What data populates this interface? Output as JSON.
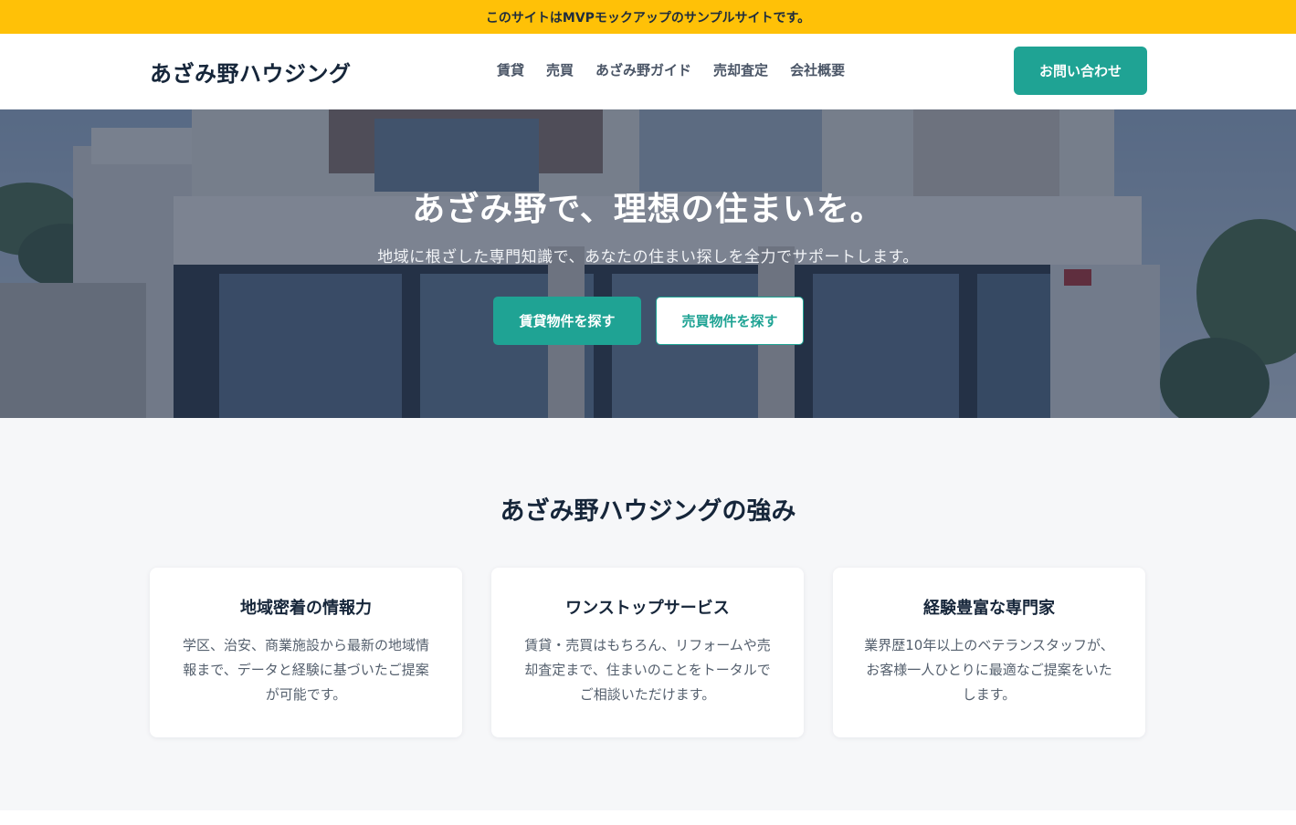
{
  "banner": {
    "text": "このサイトはMVPモックアップのサンプルサイトです。"
  },
  "header": {
    "logo": "あざみ野ハウジング",
    "nav": [
      {
        "label": "賃貸"
      },
      {
        "label": "売買"
      },
      {
        "label": "あざみ野ガイド"
      },
      {
        "label": "売却査定"
      },
      {
        "label": "会社概要"
      }
    ],
    "contact_label": "お問い合わせ"
  },
  "hero": {
    "title": "あざみ野で、理想の住まいを。",
    "subtitle": "地域に根ざした専門知識で、あなたの住まい探しを全力でサポートします。",
    "primary_button": "賃貸物件を探す",
    "secondary_button": "売買物件を探す"
  },
  "strengths": {
    "title": "あざみ野ハウジングの強み",
    "cards": [
      {
        "title": "地域密着の情報力",
        "text": "学区、治安、商業施設から最新の地域情報まで、データと経験に基づいたご提案が可能です。"
      },
      {
        "title": "ワンストップサービス",
        "text": "賃貸・売買はもちろん、リフォームや売却査定まで、住まいのことをトータルでご相談いただけます。"
      },
      {
        "title": "経験豊富な専門家",
        "text": "業界歴10年以上のベテランスタッフが、お客様一人ひとりに最適なご提案をいたします。"
      }
    ]
  },
  "colors": {
    "banner": "#ffc107",
    "accent": "#1fa394",
    "heading": "#16263a"
  }
}
